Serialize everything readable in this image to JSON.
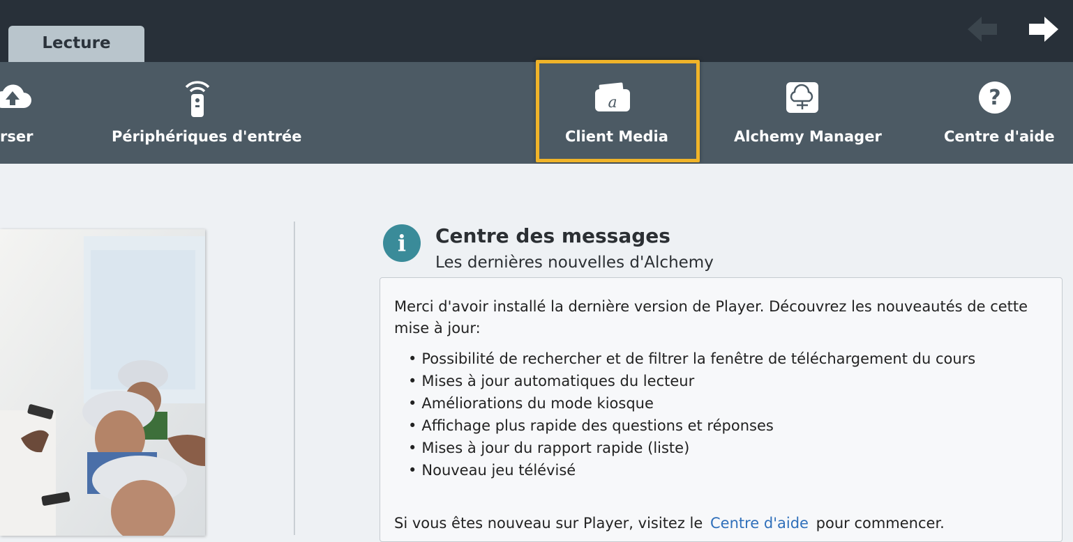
{
  "tabs": [
    {
      "label": "Lecture"
    }
  ],
  "nav": {
    "back_icon": "arrow-left-icon",
    "forward_icon": "arrow-right-icon"
  },
  "toolbar": {
    "items": [
      {
        "label": "rser",
        "icon": "cloud-upload-icon"
      },
      {
        "label": "Périphériques d'entrée",
        "icon": "remote-control-icon"
      },
      {
        "label": "Client Media",
        "icon": "client-media-icon"
      },
      {
        "label": "Alchemy Manager",
        "icon": "cloud-sync-icon"
      },
      {
        "label": "Centre d'aide",
        "icon": "help-icon"
      }
    ],
    "highlighted": "Client Media",
    "highlight_color": "#f0b429"
  },
  "message_center": {
    "title": "Centre des messages",
    "subtitle": "Les dernières nouvelles d'Alchemy",
    "intro": "Merci d'avoir installé la dernière version de Player. Découvrez les nouveautés de cette mise à jour:",
    "items": [
      "Possibilité de rechercher et de filtrer la fenêtre de téléchargement du cours",
      "Mises à jour automatiques du lecteur",
      "Améliorations du mode kiosque",
      "Affichage plus rapide des questions et réponses",
      "Mises à jour du rapport rapide (liste)",
      "Nouveau jeu télévisé"
    ],
    "footer_before": "Si vous êtes nouveau sur Player, visitez le",
    "footer_link": "Centre d'aide",
    "footer_after": "pour commencer."
  },
  "colors": {
    "topbar": "#283039",
    "toolbar": "#4c5a64",
    "accent_info": "#3a8b99",
    "link": "#2f6fba"
  }
}
